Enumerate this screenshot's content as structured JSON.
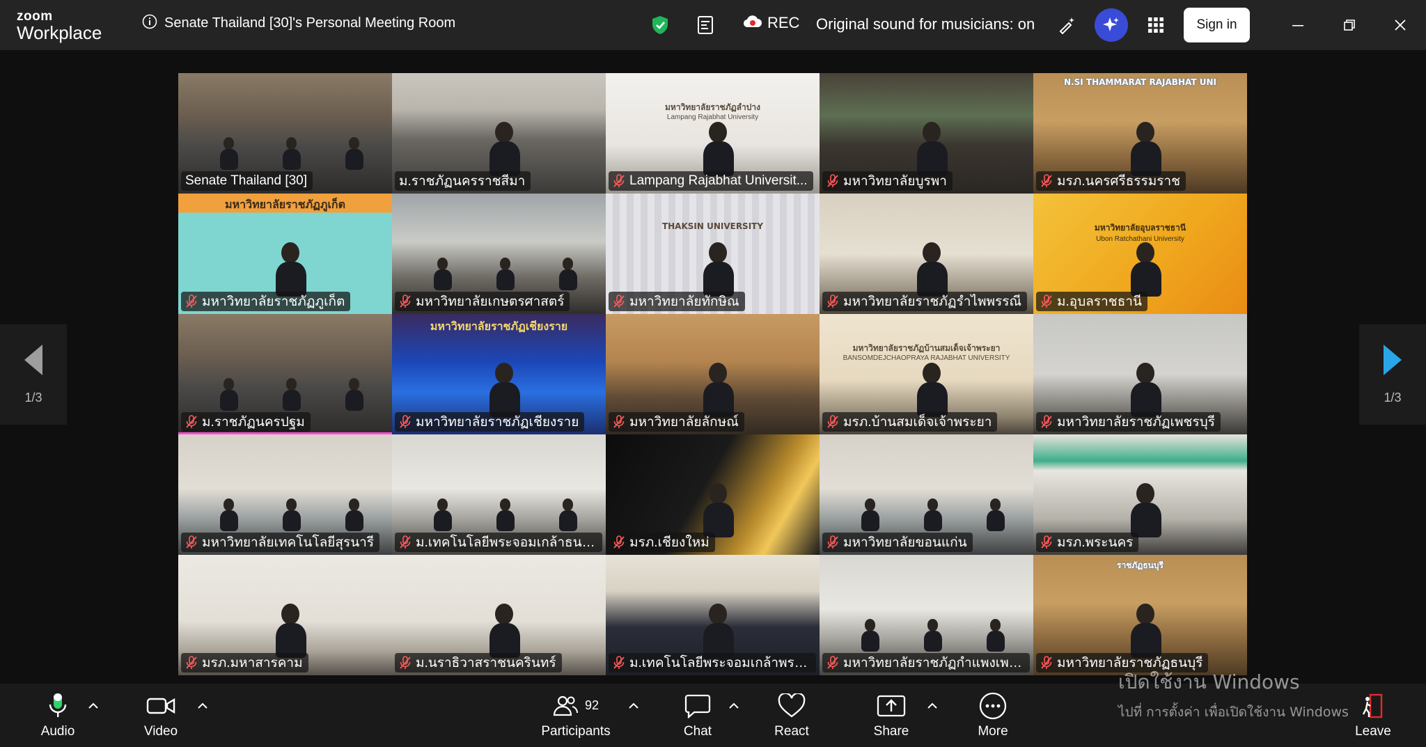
{
  "app": {
    "logo_line1": "zoom",
    "logo_line2": "Workplace"
  },
  "meeting": {
    "title": "Senate Thailand [30]'s Personal Meeting Room"
  },
  "topbar": {
    "rec_label": "REC",
    "original_sound": "Original sound for musicians: on",
    "signin_label": "Sign in",
    "icons": [
      "info-icon",
      "shield-check-icon",
      "captions-icon",
      "cloud-record-icon",
      "magic-pen-icon",
      "ai-companion-icon",
      "apps-grid-icon",
      "minimize-icon",
      "restore-icon",
      "close-icon"
    ]
  },
  "gallery": {
    "page_left": "1/3",
    "page_right": "1/3",
    "tiles": [
      {
        "name": "Senate Thailand [30]",
        "muted": false,
        "scene": "room"
      },
      {
        "name": "ม.ราชภัฏนครราชสีมา",
        "muted": false,
        "scene": "speaker",
        "active": true
      },
      {
        "name": "Lampang Rajabhat Universit...",
        "muted": true,
        "scene": "banner-white",
        "banner": "มหาวิทยาลัยราชภัฏลำปาง",
        "banner2": "Lampang Rajabhat University"
      },
      {
        "name": "มหาวิทยาลัยบูรพา",
        "muted": true,
        "scene": "dark-room"
      },
      {
        "name": "มรภ.นครศรีธรรมราช",
        "muted": true,
        "scene": "gold-wall",
        "banner": "N.SI THAMMARAT RAJABHAT UNI"
      },
      {
        "name": "มหาวิทยาลัยราชภัฏภูเก็ต",
        "muted": true,
        "scene": "teal",
        "banner": "มหาวิทยาลัยราชภัฏภูเก็ต"
      },
      {
        "name": "มหาวิทยาลัยเกษตรศาสตร์",
        "muted": true,
        "scene": "office"
      },
      {
        "name": "มหาวิทยาลัยทักษิณ",
        "muted": true,
        "scene": "curtain",
        "banner": "THAKSIN UNIVERSITY"
      },
      {
        "name": "มหาวิทยาลัยราชภัฏรำไพพรรณี",
        "muted": true,
        "scene": "emblem"
      },
      {
        "name": "ม.อุบลราชธานี",
        "muted": true,
        "scene": "yellow",
        "banner": "มหาวิทยาลัยอุบลราชธานี",
        "banner2": "Ubon Ratchathani University"
      },
      {
        "name": "ม.ราชภัฏนครปฐม",
        "muted": true,
        "scene": "room",
        "pink": true
      },
      {
        "name": "มหาวิทยาลัยราชภัฏเชียงราย",
        "muted": true,
        "scene": "blue-stage",
        "banner": "มหาวิทยาลัยราชภัฏเชียงราย"
      },
      {
        "name": "มหาวิทยาลัยลักษณ์",
        "muted": true,
        "scene": "wood-room"
      },
      {
        "name": "มรภ.บ้านสมเด็จเจ้าพระยา",
        "muted": true,
        "scene": "beige",
        "banner": "มหาวิทยาลัยราชภัฏบ้านสมเด็จเจ้าพระยา",
        "banner2": "BANSOMDEJCHAOPRAYA RAJABHAT UNIVERSITY"
      },
      {
        "name": "มหาวิทยาลัยราชภัฏเพชรบุรี",
        "muted": true,
        "scene": "grey-room"
      },
      {
        "name": "มหาวิทยาลัยเทคโนโลยีสุรนารี",
        "muted": true,
        "scene": "meeting"
      },
      {
        "name": "ม.เทคโนโลยีพระจอมเกล้าธนบุรี",
        "muted": true,
        "scene": "meeting2"
      },
      {
        "name": "มรภ.เชียงใหม่",
        "muted": true,
        "scene": "gold-dark"
      },
      {
        "name": "มหาวิทยาลัยขอนแก่น",
        "muted": true,
        "scene": "meeting"
      },
      {
        "name": "มรภ.พระนคร",
        "muted": true,
        "scene": "green-sign"
      },
      {
        "name": "มรภ.มหาสารคาม",
        "muted": true,
        "scene": "white-room"
      },
      {
        "name": "ม.นราธิวาสราชนครินทร์",
        "muted": true,
        "scene": "white-room"
      },
      {
        "name": "ม.เทคโนโลยีพระจอมเกล้าพระนคร...",
        "muted": true,
        "scene": "close-up"
      },
      {
        "name": "มหาวิทยาลัยราชภัฏกำแพงเพชร",
        "muted": true,
        "scene": "meeting2"
      },
      {
        "name": "มหาวิทยาลัยราชภัฏธนบุรี",
        "muted": true,
        "scene": "gold-wall",
        "banner": "ราชภัฏธนบุรี"
      }
    ]
  },
  "toolbar": {
    "audio": "Audio",
    "video": "Video",
    "participants": "Participants",
    "participant_count": "92",
    "chat": "Chat",
    "react": "React",
    "share": "Share",
    "more": "More",
    "leave": "Leave"
  },
  "watermark": {
    "line1": "เปิดใช้งาน Windows",
    "line2": "ไปที่ การตั้งค่า เพื่อเปิดใช้งาน Windows"
  }
}
